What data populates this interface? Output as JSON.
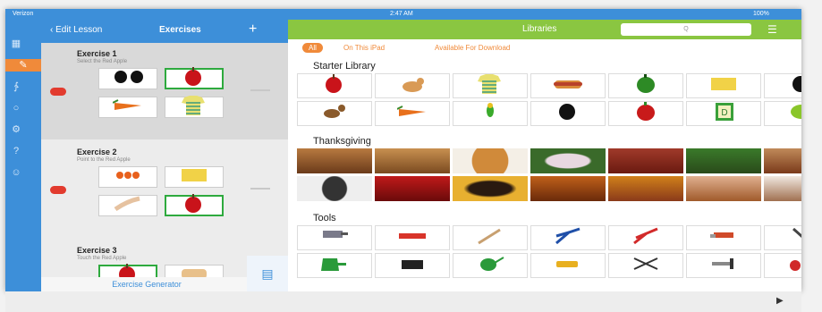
{
  "status": {
    "left": "Verizon",
    "time": "2:47 AM",
    "right": "100%"
  },
  "nav": {
    "back_label": "Edit Lesson",
    "title": "Exercises",
    "add_label": "+"
  },
  "rail_icons": [
    "book-icon",
    "pencil-icon",
    "share-icon",
    "globe-icon",
    "settings-icon",
    "help-icon",
    "profile-icon"
  ],
  "rail_active_index": 1,
  "exercises": [
    {
      "title": "Exercise 1",
      "subtitle": "Select the Red Apple",
      "tiles": [
        "black-dots",
        "red-apple",
        "carrots",
        "striped-shirt"
      ],
      "correct_index": 1
    },
    {
      "title": "Exercise 2",
      "subtitle": "Point to the Red Apple",
      "tiles": [
        "shrimp",
        "sponge",
        "hand",
        "red-apple"
      ],
      "correct_index": 3
    },
    {
      "title": "Exercise 3",
      "subtitle": "Touch the Red Apple",
      "tiles": [
        "red-apple",
        "bread"
      ],
      "correct_index": 0
    }
  ],
  "generator_label": "Exercise Generator",
  "library": {
    "title": "Libraries",
    "search_placeholder": "Q",
    "filters": [
      "All",
      "On This iPad",
      "Available For Download"
    ],
    "active_filter": 0,
    "sections": [
      {
        "title": "Starter Library",
        "rows": [
          [
            "red-apple",
            "cat",
            "striped-shirt",
            "hot-dog",
            "green-pepper",
            "sponge",
            "black-dot"
          ],
          [
            "dog",
            "carrots",
            "parrot",
            "black-dot",
            "red-pepper",
            "d-block",
            "lime"
          ]
        ]
      },
      {
        "title": "Thanksgiving",
        "rows": [
          [
            "pilgrims",
            "bread",
            "pie",
            "turkey-platter",
            "dinner",
            "turkey",
            "roast"
          ],
          [
            "pilgrim",
            "apples",
            "pilgrim-hat",
            "roast-turkey",
            "feast",
            "turkey-dish",
            "table"
          ]
        ]
      },
      {
        "title": "Tools",
        "rows": [
          [
            "drill",
            "level",
            "paintbrush",
            "pliers",
            "wire-cutters",
            "chainsaw",
            "screwdriver"
          ],
          [
            "dustpan",
            "paint-tray",
            "watering-can",
            "flashlight",
            "shears",
            "caulk-gun",
            "ear-muffs"
          ]
        ]
      }
    ]
  },
  "colors": {
    "accent": "#3d8fd9",
    "library": "#8ac641",
    "active": "#f08a3a",
    "correct": "#2eaa3e",
    "dot": "#e23b2e"
  }
}
